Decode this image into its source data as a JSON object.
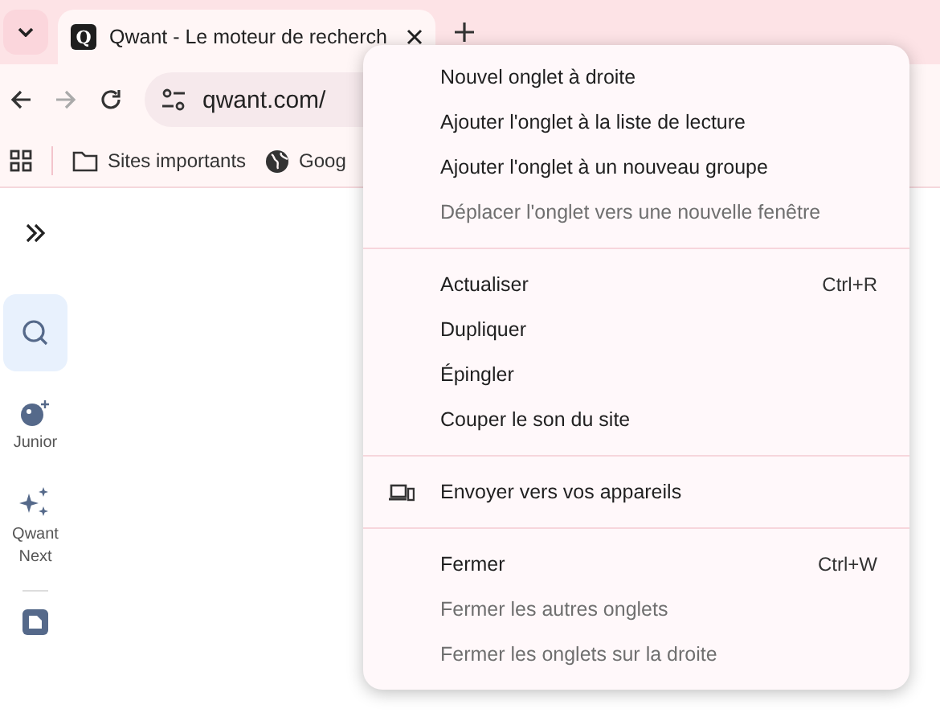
{
  "tab": {
    "favicon": "Q",
    "title": "Qwant - Le moteur de recherch"
  },
  "address": {
    "value": "qwant.com/"
  },
  "bookmarks": [
    {
      "kind": "folder",
      "label": "Sites importants"
    },
    {
      "kind": "globe",
      "label": "Goog"
    }
  ],
  "sidebar": {
    "items": [
      {
        "kind": "search",
        "selected": true
      },
      {
        "kind": "junior",
        "label": "Junior",
        "selected": false
      },
      {
        "kind": "next",
        "label": "Qwant Next",
        "selected": false
      }
    ]
  },
  "menu": {
    "sections": [
      [
        {
          "kind": "plain",
          "label": "Nouvel onglet à droite",
          "disabled": false
        },
        {
          "kind": "plain",
          "label": "Ajouter l'onglet à la liste de lecture",
          "disabled": false
        },
        {
          "kind": "plain",
          "label": "Ajouter l'onglet à un nouveau groupe",
          "disabled": false
        },
        {
          "kind": "plain",
          "label": "Déplacer l'onglet vers une nouvelle fenêtre",
          "disabled": true
        }
      ],
      [
        {
          "kind": "plain",
          "label": "Actualiser",
          "shortcut": "Ctrl+R",
          "disabled": false
        },
        {
          "kind": "plain",
          "label": "Dupliquer",
          "disabled": false
        },
        {
          "kind": "plain",
          "label": "Épingler",
          "disabled": false
        },
        {
          "kind": "plain",
          "label": "Couper le son du site",
          "disabled": false
        }
      ],
      [
        {
          "kind": "device",
          "label": "Envoyer vers vos appareils",
          "disabled": false
        }
      ],
      [
        {
          "kind": "plain",
          "label": "Fermer",
          "shortcut": "Ctrl+W",
          "disabled": false
        },
        {
          "kind": "plain",
          "label": "Fermer les autres onglets",
          "disabled": true
        },
        {
          "kind": "plain",
          "label": "Fermer les onglets sur la droite",
          "disabled": true
        }
      ]
    ]
  }
}
